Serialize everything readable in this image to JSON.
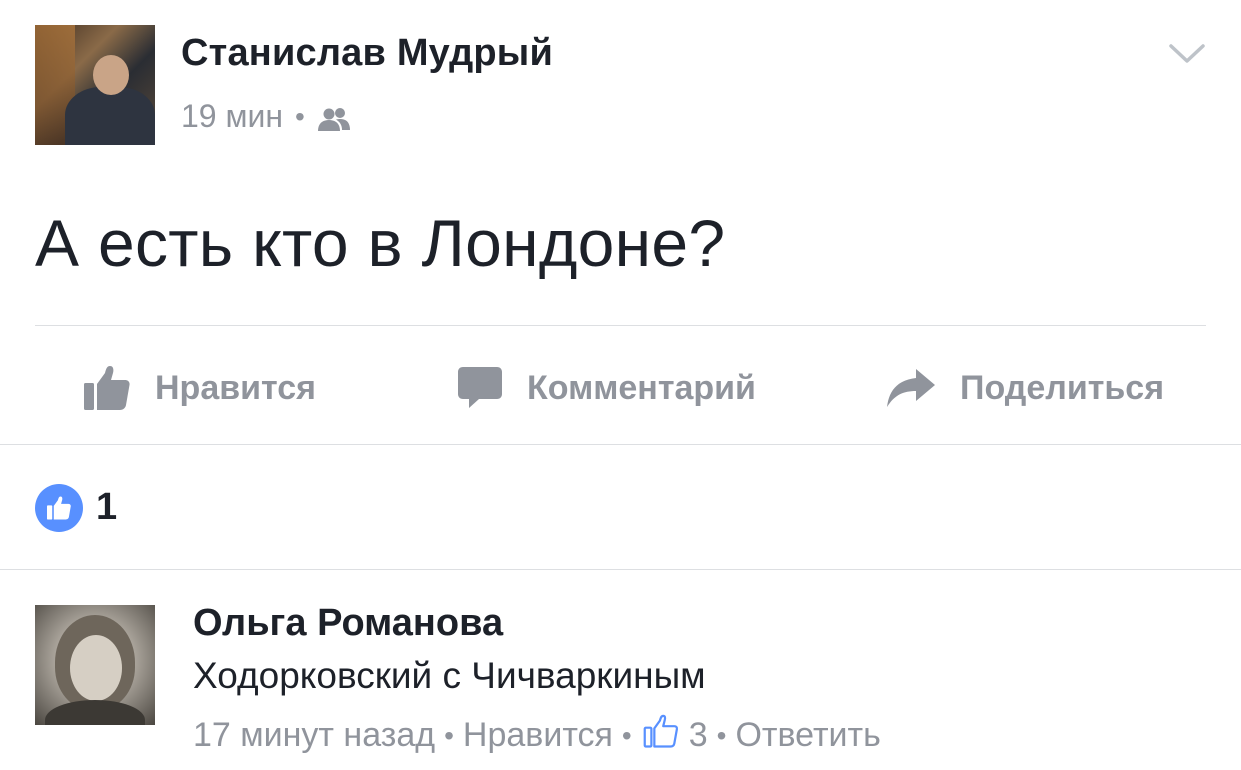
{
  "post": {
    "author": "Станислав Мудрый",
    "time": "19 мин",
    "meta_separator": "•",
    "audience_icon": "friends-icon",
    "text": "А есть кто в Лондоне?"
  },
  "actions": {
    "like_label": "Нравится",
    "comment_label": "Комментарий",
    "share_label": "Поделиться"
  },
  "reactions": {
    "like_count": "1",
    "badge_color": "#5890ff"
  },
  "comment": {
    "author": "Ольга Романова",
    "text": "Ходорковский с Чичваркиным",
    "time": "17 минут назад",
    "separator": "•",
    "like_label": "Нравится",
    "like_count": "3",
    "reply_label": "Ответить"
  },
  "colors": {
    "text_primary": "#1d2129",
    "text_secondary": "#90949c",
    "divider": "#dddfe2"
  }
}
